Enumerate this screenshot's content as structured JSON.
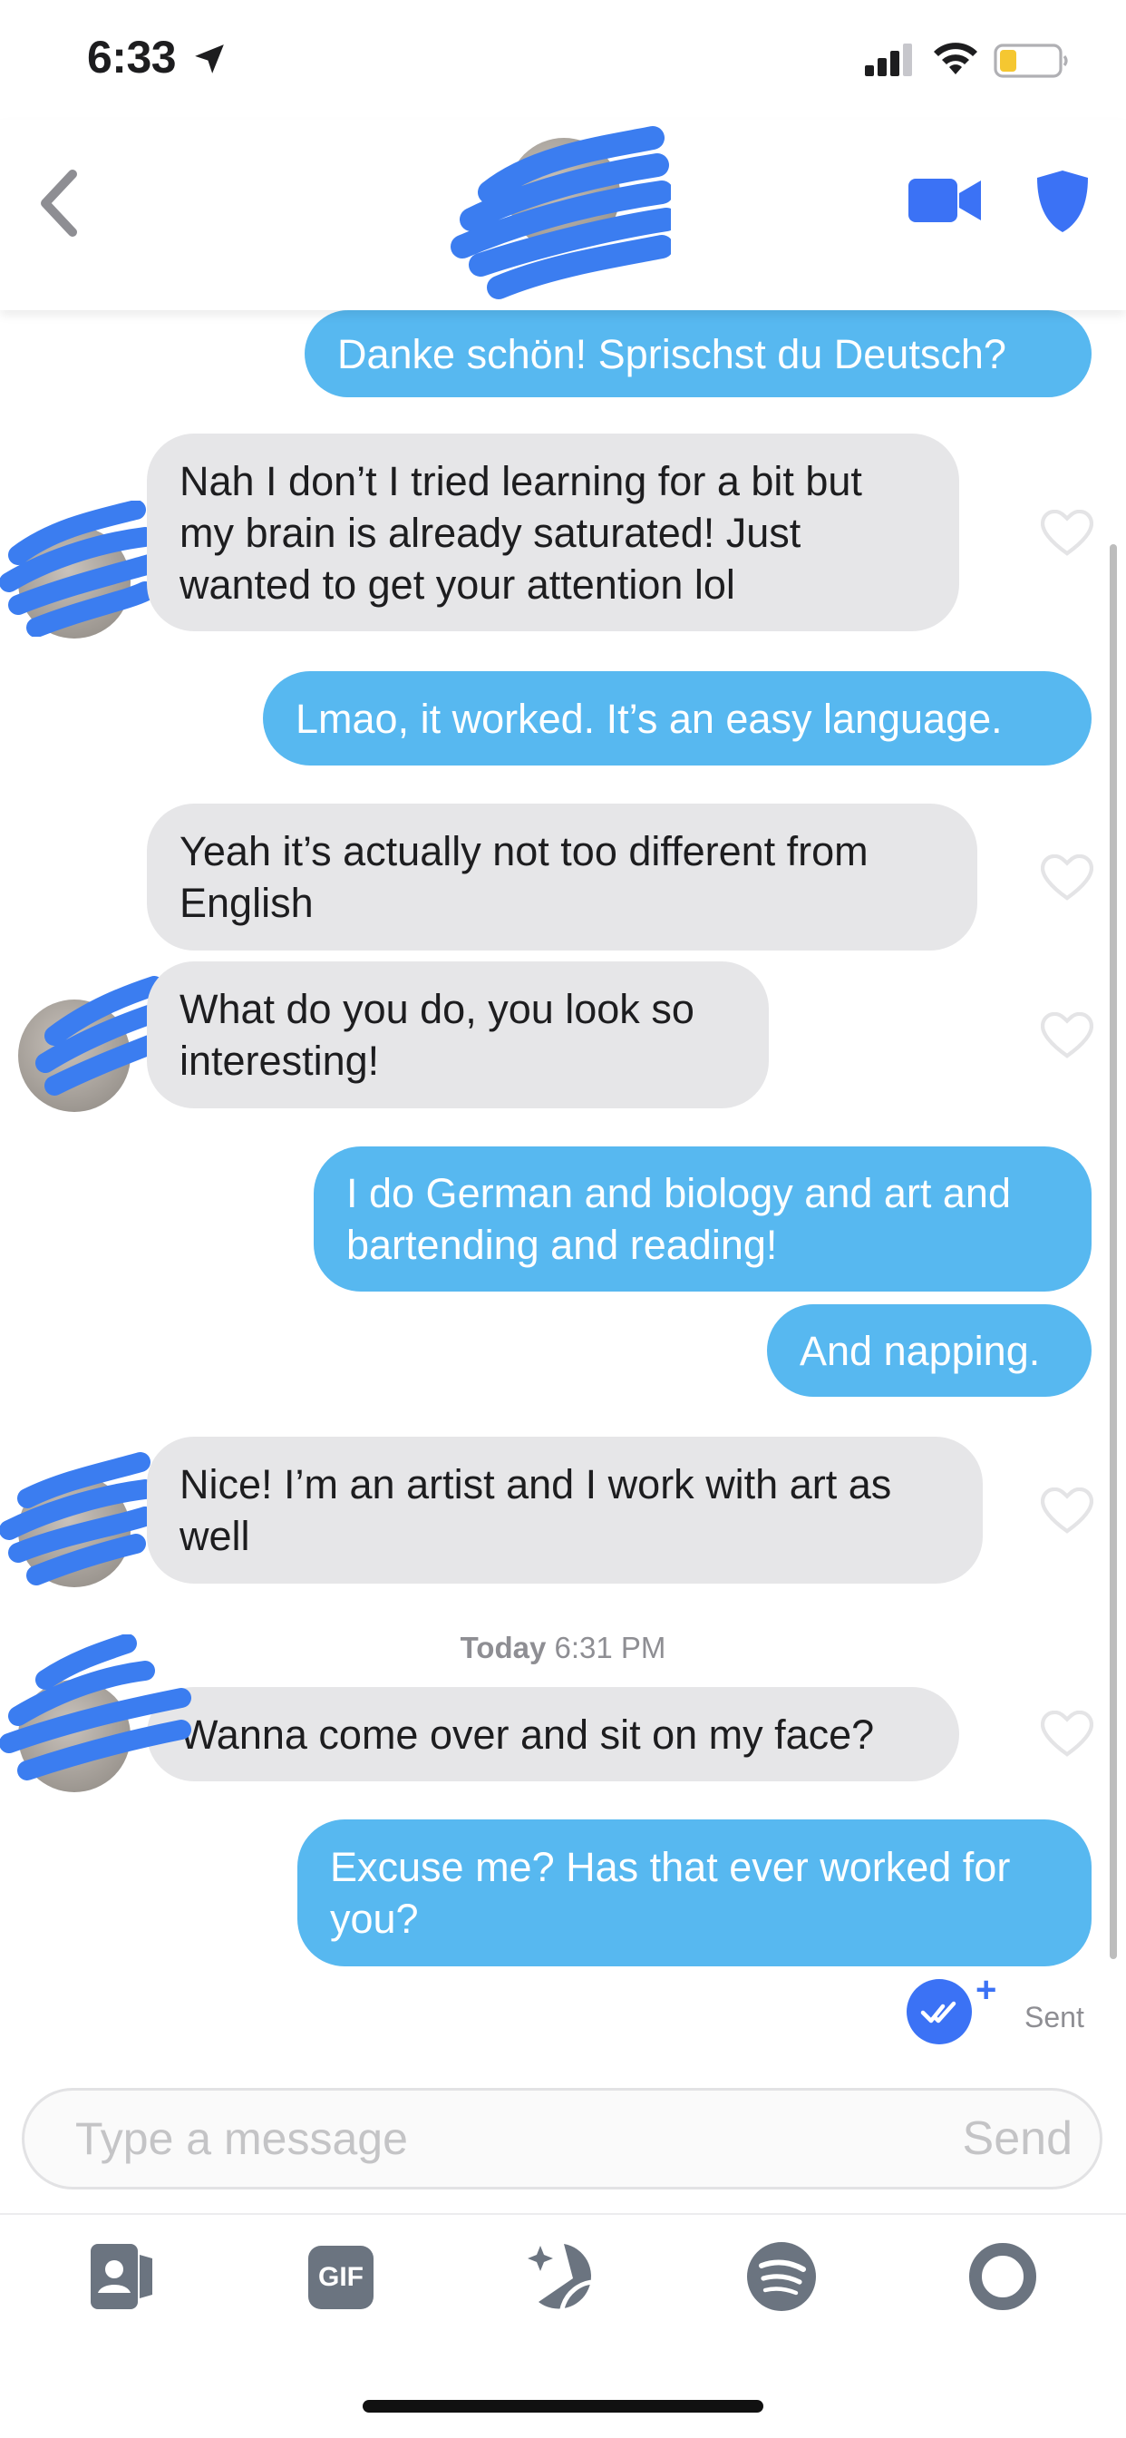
{
  "status_bar": {
    "time": "6:33"
  },
  "conversation": {
    "messages": [
      {
        "dir": "out",
        "text": "Danke schön! Sprischst du Deutsch?"
      },
      {
        "dir": "in",
        "text": "Nah I don’t I tried learning for a bit but my brain is already saturated! Just wanted to get your attention lol"
      },
      {
        "dir": "out",
        "text": "Lmao, it worked. It’s an easy language."
      },
      {
        "dir": "in",
        "text": "Yeah it’s actually not too different from English"
      },
      {
        "dir": "in",
        "text": "What do you do, you look so interesting!"
      },
      {
        "dir": "out",
        "text": "I do German and biology and art and bartending and reading!"
      },
      {
        "dir": "out",
        "text": "And napping."
      },
      {
        "dir": "in",
        "text": "Nice! I’m an artist and I work with art as well"
      },
      {
        "dir": "in",
        "text": "Wanna come over and sit on my face?"
      },
      {
        "dir": "out",
        "text": "Excuse me? Has that ever worked for you?"
      }
    ],
    "timestamp_day": "Today",
    "timestamp_time": "6:31 PM",
    "status": "Sent"
  },
  "composer": {
    "placeholder": "Type a message",
    "send_label": "Send"
  },
  "toolbar": {
    "items": [
      "contact-card-icon",
      "gif-icon",
      "sticker-icon",
      "spotify-icon",
      "loop-icon"
    ],
    "gif_label": "GIF"
  },
  "colors": {
    "outgoing_bubble": "#57b8f0",
    "incoming_bubble": "#e6e6e8",
    "accent": "#3b72f5",
    "scribble": "#3b7df0"
  }
}
